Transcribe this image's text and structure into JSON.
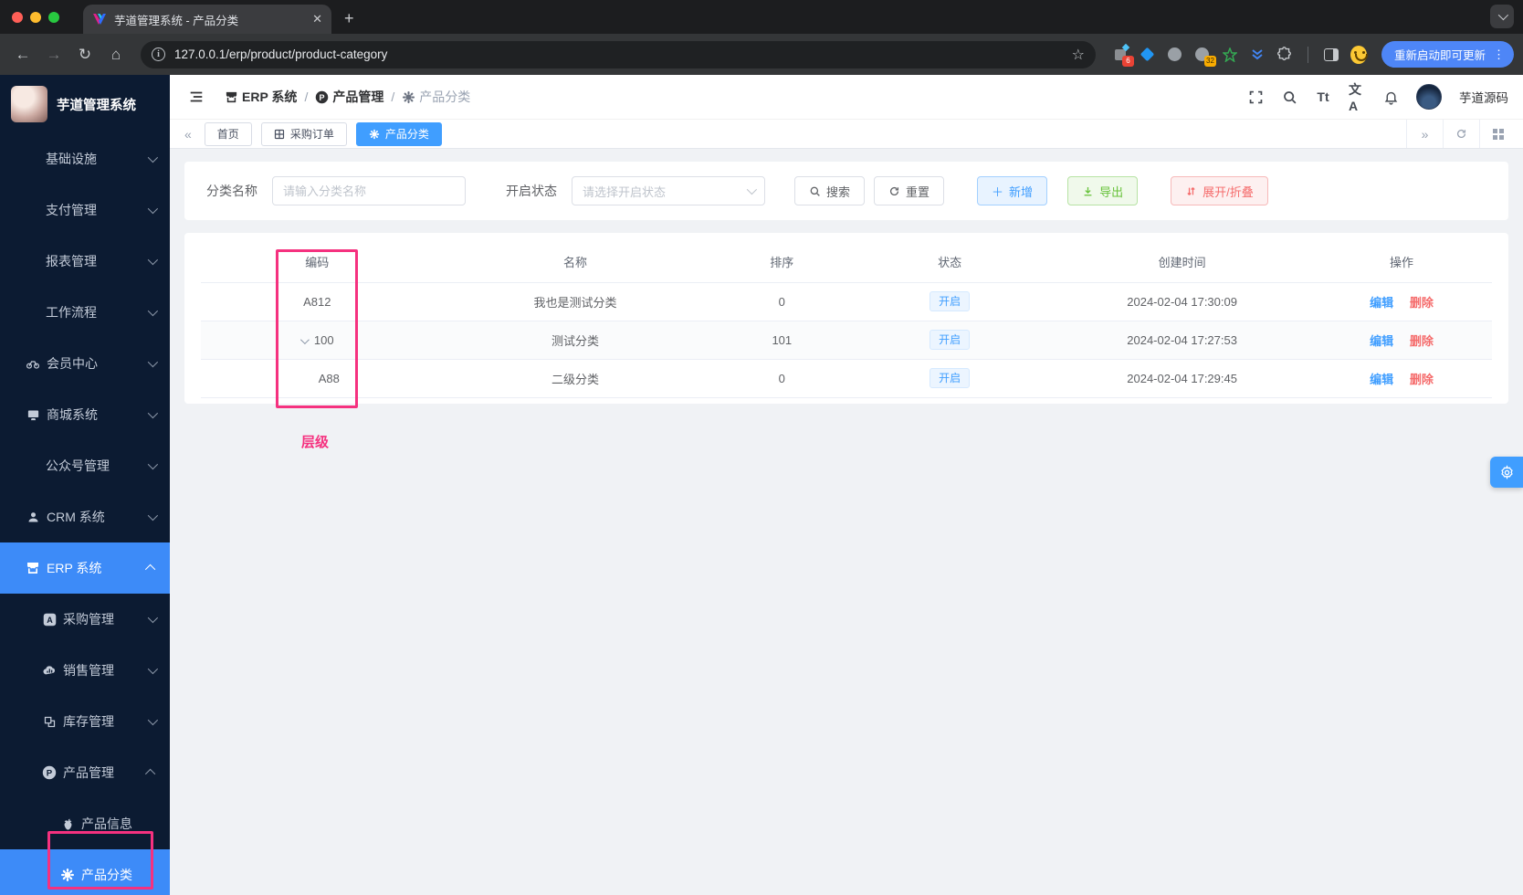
{
  "browser": {
    "tab_title": "芋道管理系统 - 产品分类",
    "close_glyph": "✕",
    "url": "127.0.0.1/erp/product/product-category",
    "update_button": "重新启动即可更新",
    "badge_red": "6",
    "badge_orange": "32"
  },
  "sidebar": {
    "app_title": "芋道管理系统",
    "menu": [
      {
        "label": "基础设施"
      },
      {
        "label": "支付管理"
      },
      {
        "label": "报表管理"
      },
      {
        "label": "工作流程"
      },
      {
        "label": "会员中心"
      },
      {
        "label": "商城系统"
      },
      {
        "label": "公众号管理"
      },
      {
        "label": "CRM 系统"
      },
      {
        "label": "ERP 系统"
      },
      {
        "label": "采购管理"
      },
      {
        "label": "销售管理"
      },
      {
        "label": "库存管理"
      },
      {
        "label": "产品管理"
      },
      {
        "label": "产品信息"
      },
      {
        "label": "产品分类"
      }
    ]
  },
  "header": {
    "breadcrumb": [
      "ERP 系统",
      "产品管理",
      "产品分类"
    ],
    "font_glyph": "Tt",
    "lang_glyph": "文A",
    "username": "芋道源码"
  },
  "tabs": [
    {
      "label": "首页"
    },
    {
      "label": "采购订单"
    },
    {
      "label": "产品分类"
    }
  ],
  "filters": {
    "name_label": "分类名称",
    "name_placeholder": "请输入分类名称",
    "status_label": "开启状态",
    "status_placeholder": "请选择开启状态",
    "search_label": "搜索",
    "reset_label": "重置",
    "add_label": "新增",
    "export_label": "导出",
    "expand_label": "展开/折叠"
  },
  "table": {
    "columns": [
      "编码",
      "名称",
      "排序",
      "状态",
      "创建时间",
      "操作"
    ],
    "rows": [
      {
        "code": "A812",
        "name": "我也是测试分类",
        "sort": "0",
        "status": "开启",
        "created": "2024-02-04 17:30:09",
        "edit": "编辑",
        "del": "删除"
      },
      {
        "code": "100",
        "name": "测试分类",
        "sort": "101",
        "status": "开启",
        "created": "2024-02-04 17:27:53",
        "edit": "编辑",
        "del": "删除"
      },
      {
        "code": "A88",
        "name": "二级分类",
        "sort": "0",
        "status": "开启",
        "created": "2024-02-04 17:29:45",
        "edit": "编辑",
        "del": "删除"
      }
    ]
  },
  "annotation": {
    "label": "层级",
    "color": "#f5317f"
  },
  "colors": {
    "accent": "#409eff",
    "success": "#67c23a",
    "danger": "#f56c6c",
    "sidebar_bg": "#0c1b32",
    "annotation": "#f5317f"
  }
}
